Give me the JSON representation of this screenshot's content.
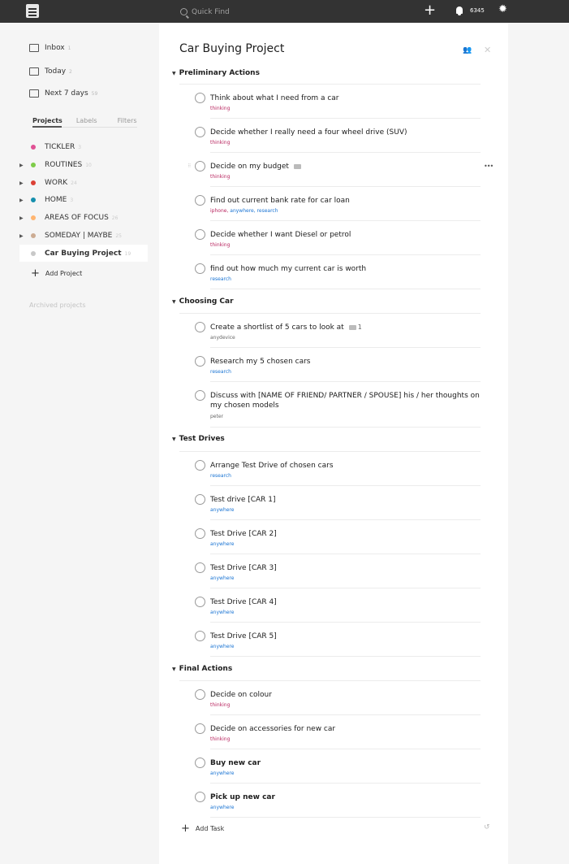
{
  "topbar": {
    "search_placeholder": "Quick Find",
    "karma": "6345"
  },
  "sidebar": {
    "inbox": {
      "label": "Inbox",
      "count": "1"
    },
    "today": {
      "label": "Today",
      "count": "2"
    },
    "next7": {
      "label": "Next 7 days",
      "count": "59"
    },
    "tabs": [
      "Projects",
      "Labels",
      "Filters"
    ],
    "projects": [
      {
        "name": "TICKLER",
        "count": "3",
        "color": "#e05194",
        "expandable": false
      },
      {
        "name": "ROUTINES",
        "count": "10",
        "color": "#7ecc49",
        "expandable": true
      },
      {
        "name": "WORK",
        "count": "24",
        "color": "#db4035",
        "expandable": true
      },
      {
        "name": "HOME",
        "count": "3",
        "color": "#158fad",
        "expandable": true
      },
      {
        "name": "AREAS OF FOCUS",
        "count": "26",
        "color": "#ffb570",
        "expandable": true
      },
      {
        "name": "SOMEDAY | MAYBE",
        "count": "25",
        "color": "#ccac93",
        "expandable": true
      },
      {
        "name": "Car Buying Project",
        "count": "19",
        "color": "#c8c8c8",
        "expandable": false
      }
    ],
    "add_project": "Add Project",
    "archived": "Archived projects"
  },
  "main": {
    "title": "Car Buying Project",
    "sections": [
      {
        "title": "Preliminary Actions"
      },
      {
        "title": "Choosing Car"
      },
      {
        "title": "Test Drives"
      },
      {
        "title": "Final Actions"
      }
    ],
    "tasks": [
      {
        "name": "Think about what I need from a car",
        "labels": [
          "thinking"
        ]
      },
      {
        "name": "Decide whether I really need a four wheel drive (SUV)",
        "labels": [
          "thinking"
        ]
      },
      {
        "name": "Decide on my budget",
        "labels": [
          "thinking"
        ],
        "comment": true
      },
      {
        "name": "Find out current bank rate for car loan",
        "labels": [
          "iphone, ",
          "anywhere, ",
          "research"
        ]
      },
      {
        "name": "Decide whether I want Diesel or petrol",
        "labels": [
          "thinking"
        ]
      },
      {
        "name": "find out how much my current car is worth",
        "labels": [
          "research"
        ]
      },
      {
        "name": "Create a shortlist of 5 cars to look at",
        "labels": [
          "anydevice"
        ],
        "comment": true,
        "comment_count": "1"
      },
      {
        "name": "Research my 5 chosen cars",
        "labels": [
          "research"
        ]
      },
      {
        "name": "Discuss with [NAME OF FRIEND/ PARTNER / SPOUSE] his / her thoughts on my chosen models",
        "labels": [
          "peter"
        ]
      },
      {
        "name": "Arrange Test Drive of chosen cars",
        "labels": [
          "research"
        ]
      },
      {
        "name": "Test drive [CAR 1]",
        "labels": [
          "anywhere"
        ]
      },
      {
        "name": "Test Drive [CAR 2]",
        "labels": [
          "anywhere"
        ]
      },
      {
        "name": "Test Drive [CAR 3]",
        "labels": [
          "anywhere"
        ]
      },
      {
        "name": "Test Drive [CAR 4]",
        "labels": [
          "anywhere"
        ]
      },
      {
        "name": "Test Drive [CAR 5]",
        "labels": [
          "anywhere"
        ]
      },
      {
        "name": "Decide on colour",
        "labels": [
          "thinking"
        ]
      },
      {
        "name": "Decide on accessories for new car",
        "labels": [
          "thinking"
        ]
      },
      {
        "name": "Buy new car",
        "labels": [
          "anywhere"
        ]
      },
      {
        "name": "Pick up new car",
        "labels": [
          "anywhere"
        ]
      }
    ],
    "add_task": "Add Task"
  },
  "colors": {
    "label_red": "#b8255f",
    "label_blue": "#1873d3",
    "topbar": "#333333"
  }
}
